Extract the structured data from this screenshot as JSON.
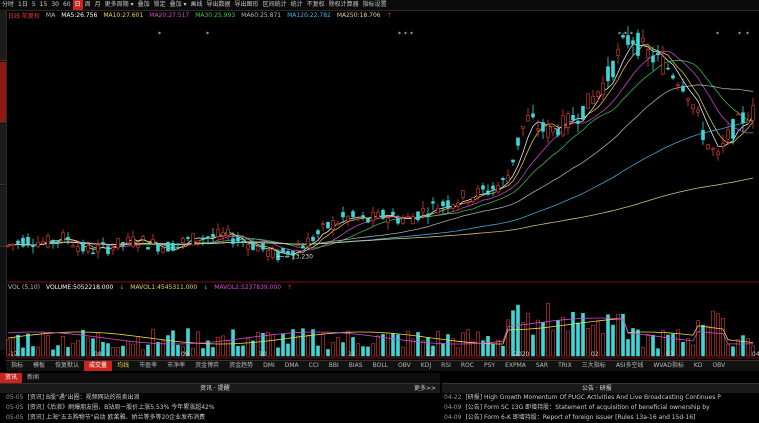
{
  "toolbar": {
    "items": [
      "分时",
      "1日",
      "5",
      "15",
      "30",
      "60",
      "日",
      "周",
      "月",
      "更多周期 ▾",
      "叠加",
      "锁定",
      "叠加 ▾",
      "画线",
      "导出数据",
      "导出图形",
      "区间统计",
      "统计",
      "不复权",
      "除权计算器",
      "指标设置"
    ],
    "active_index": 6
  },
  "ma_legend": [
    {
      "label": "日线 前复权",
      "color": "#e23b2e"
    },
    {
      "label": "MA",
      "color": "#bbbbbb"
    },
    {
      "label": "MA5:26.756",
      "color": "#ffffff"
    },
    {
      "label": "MA10:27.601",
      "color": "#e9d84b"
    },
    {
      "label": "MA20:27.517",
      "color": "#d94bd5"
    },
    {
      "label": "MA30:25.993",
      "color": "#3ccb4b"
    },
    {
      "label": "MA60:25.871",
      "color": "#bbbbbb"
    },
    {
      "label": "MA120:22.782",
      "color": "#3fb8e8"
    },
    {
      "label": "MA250:18.706",
      "color": "#e8d18d"
    },
    {
      "label": "↑",
      "color": "#e23b2e"
    }
  ],
  "vol_legend": [
    {
      "label": "VOL (5,10)",
      "color": "#bbbbbb"
    },
    {
      "label": "VOLUME:5052218.000",
      "color": "#ffffff"
    },
    {
      "label": "↓",
      "color": "#3ccb4b"
    },
    {
      "label": "MAVOL1:4545311.000",
      "color": "#e9d84b"
    },
    {
      "label": "↓",
      "color": "#3ccb4b"
    },
    {
      "label": "MAVOL2:5237839.000",
      "color": "#d94bd5"
    },
    {
      "label": "↑",
      "color": "#e23b2e"
    }
  ],
  "low_price_label": "← 13.230",
  "x_labels": [
    "-17",
    "08",
    "09",
    "10",
    "11",
    "12",
    "2020",
    "02",
    "03",
    "04"
  ],
  "indicator_tabs": [
    "指标",
    "模板",
    "恢复默认",
    "成交量",
    "均线",
    "市盈率",
    "市净率",
    "资金博弈",
    "资金趋势",
    "DMI",
    "DMA",
    "CCI",
    "BBI",
    "BIAS",
    "BOLL",
    "OBV",
    "KDJ",
    "RSI",
    "ROC",
    "PSY",
    "EXPMA",
    "SAR",
    "TRIX",
    "三大指标",
    "ASI多空线",
    "WVAD指标",
    "KD",
    "OBV"
  ],
  "indicator_active_index": 3,
  "indicator_yellow_index": 4,
  "news_tabs": [
    "资讯",
    "新闻"
  ],
  "news_header": "资讯 · 提醒",
  "news_more": "更多>>",
  "news": [
    {
      "date": "05-05",
      "text": "[资讯] B股\"遇\"出圈：视频网站的前卖出浪"
    },
    {
      "date": "05-05",
      "text": "[资讯]《后浪》刷爆朋友圈，B站周一股价上涨5.53% 今年累涨超42%"
    },
    {
      "date": "05-05",
      "text": "[资讯] 上海\"五五购物节\"启动 欧莱雅、娇兰等多等20企业发布消费"
    }
  ],
  "notice_header": "公告 · 研报",
  "notices": [
    {
      "date": "04-22",
      "text": "[研报] High Growth Momentum Of PUGC Activities And Live Broadcasting Continues P"
    },
    {
      "date": "04-09",
      "text": "[公告] Form SC 13G 即增持股：Statement of acquisition of beneficial ownership by"
    },
    {
      "date": "04-09",
      "text": "[公告] Form 6-K 即增持股：Report of foreign issuer [Rules 13a-16 and 15d-16]"
    }
  ],
  "chart_data": {
    "type": "candlestick",
    "price_axis": "hidden",
    "period_labels": [
      "-17",
      "08",
      "09",
      "10",
      "11",
      "12",
      "2020",
      "02",
      "03",
      "04"
    ],
    "moving_averages": {
      "MA5": 26.756,
      "MA10": 27.601,
      "MA20": 27.517,
      "MA30": 25.993,
      "MA60": 25.871,
      "MA120": 22.782,
      "MA250": 18.706
    },
    "low_marked": 13.23,
    "price_range_estimate": [
      12.0,
      37.0
    ],
    "volume": {
      "VOLUME": 5052218,
      "MAVOL1": 4545311,
      "MAVOL2": 5237839
    },
    "up_color": "#e23b2e",
    "down_color": "#3fd6d6"
  }
}
